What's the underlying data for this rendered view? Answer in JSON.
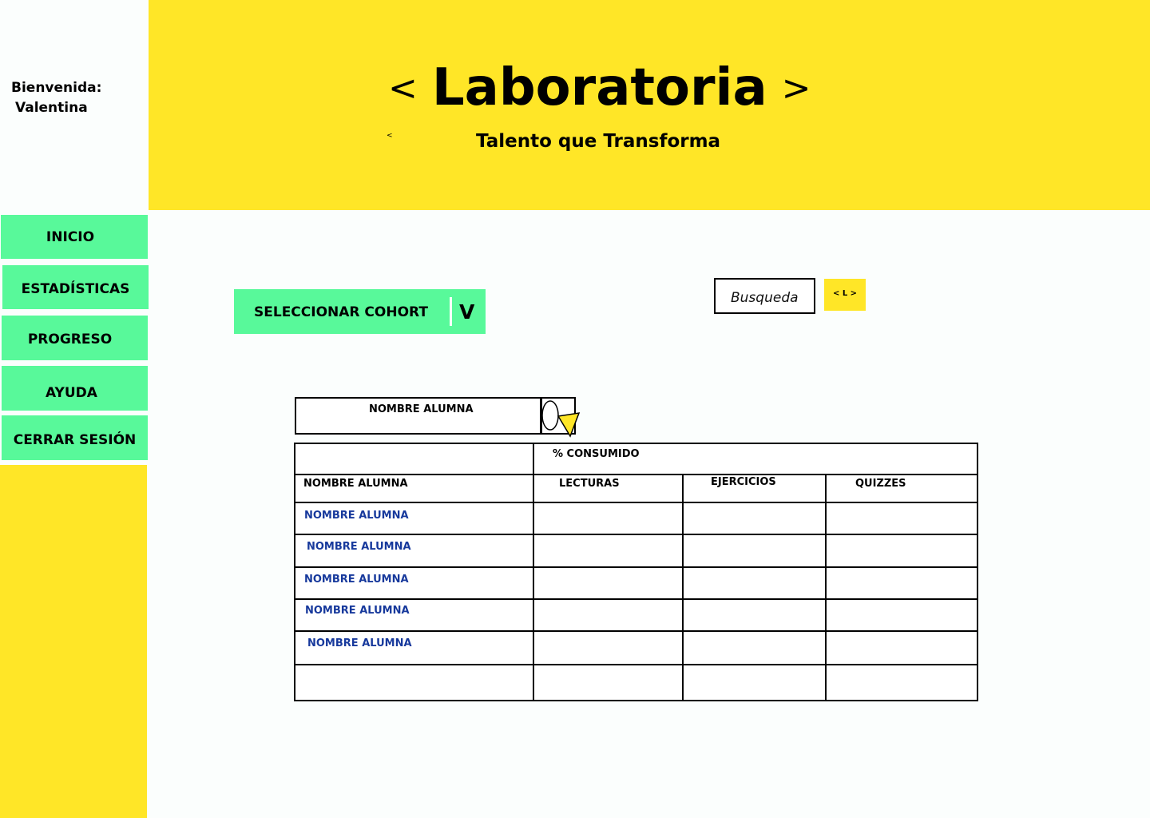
{
  "welcome": {
    "greeting": "Bienvenida:",
    "user_name": "Valentina"
  },
  "brand": {
    "left_bracket": "<",
    "title": "Laboratoria",
    "right_bracket": ">",
    "small_bracket": "<",
    "tagline": "Talento que Transforma"
  },
  "sidebar": {
    "items": [
      {
        "label": "INICIO"
      },
      {
        "label": "ESTADÍSTICAS"
      },
      {
        "label": "PROGRESO"
      },
      {
        "label": "AYUDA"
      },
      {
        "label": "CERRAR SESIÓN"
      }
    ]
  },
  "cohort_select": {
    "label": "SELECCIONAR COHORT",
    "arrow": "V"
  },
  "search": {
    "placeholder": "Busqueda",
    "button_label": "< L >"
  },
  "name_filter": {
    "label": "NOMBRE ALUMNA",
    "icon": "filter-icon"
  },
  "table": {
    "group_header": "% CONSUMIDO",
    "columns": [
      "NOMBRE ALUMNA",
      "LECTURAS",
      "EJERCICIOS",
      "QUIZZES"
    ],
    "rows": [
      "NOMBRE ALUMNA",
      "NOMBRE ALUMNA",
      "NOMBRE ALUMNA",
      "NOMBRE ALUMNA",
      "NOMBRE ALUMNA",
      ""
    ]
  },
  "colors": {
    "accent_yellow": "#ffe627",
    "nav_green": "#58f99a",
    "student_link_blue": "#17399c",
    "page_background": "#fbfefd"
  }
}
